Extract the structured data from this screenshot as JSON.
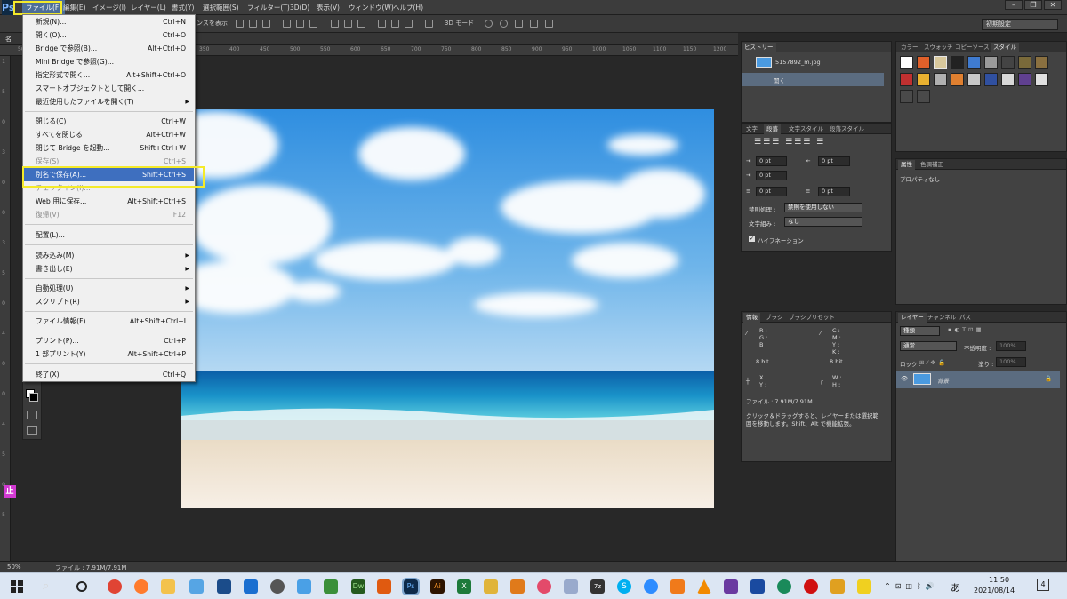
{
  "app": {
    "logo": "Ps",
    "workspace": "初期設定"
  },
  "menubar": {
    "items": [
      "ファイル(F)",
      "編集(E)",
      "イメージ(I)",
      "レイヤー(L)",
      "書式(Y)",
      "選択範囲(S)",
      "フィルター(T)",
      "3D(D)",
      "表示(V)",
      "ウィンドウ(W)",
      "ヘルプ(H)"
    ]
  },
  "options": {
    "show_transform": "ンスを表示",
    "mode_3d": "3D モード :"
  },
  "document": {
    "tab": "名",
    "zoom": "50%",
    "file_info": "ファイル : 7.91M/7.91M"
  },
  "rulers": {
    "top": [
      "50",
      "100",
      "150",
      "200",
      "250",
      "300",
      "350",
      "400",
      "450",
      "500",
      "550",
      "600",
      "650",
      "700",
      "750",
      "800",
      "850",
      "900",
      "950",
      "1000",
      "1050",
      "1100",
      "1150",
      "1200"
    ],
    "left": [
      "1",
      "5",
      "0",
      "3",
      "0",
      "0",
      "3",
      "5",
      "0",
      "4",
      "0",
      "0",
      "4",
      "5",
      "0",
      "5"
    ]
  },
  "file_menu": {
    "items": [
      {
        "label": "新規(N)...",
        "shortcut": "Ctrl+N"
      },
      {
        "label": "開く(O)...",
        "shortcut": "Ctrl+O"
      },
      {
        "label": "Bridge で参照(B)...",
        "shortcut": "Alt+Ctrl+O"
      },
      {
        "label": "Mini Bridge で参照(G)...",
        "shortcut": ""
      },
      {
        "label": "指定形式で開く...",
        "shortcut": "Alt+Shift+Ctrl+O"
      },
      {
        "label": "スマートオブジェクトとして開く...",
        "shortcut": ""
      },
      {
        "label": "最近使用したファイルを開く(T)",
        "shortcut": ""
      },
      {
        "label": "閉じる(C)",
        "shortcut": "Ctrl+W"
      },
      {
        "label": "すべてを閉じる",
        "shortcut": "Alt+Ctrl+W"
      },
      {
        "label": "閉じて Bridge を起動...",
        "shortcut": "Shift+Ctrl+W"
      },
      {
        "label": "保存(S)",
        "shortcut": "Ctrl+S"
      },
      {
        "label": "別名で保存(A)...",
        "shortcut": "Shift+Ctrl+S"
      },
      {
        "label": "チェックイン(I)...",
        "shortcut": ""
      },
      {
        "label": "Web 用に保存...",
        "shortcut": "Alt+Shift+Ctrl+S"
      },
      {
        "label": "復帰(V)",
        "shortcut": "F12"
      },
      {
        "label": "配置(L)...",
        "shortcut": ""
      },
      {
        "label": "読み込み(M)",
        "shortcut": ""
      },
      {
        "label": "書き出し(E)",
        "shortcut": ""
      },
      {
        "label": "自動処理(U)",
        "shortcut": ""
      },
      {
        "label": "スクリプト(R)",
        "shortcut": ""
      },
      {
        "label": "ファイル情報(F)...",
        "shortcut": "Alt+Shift+Ctrl+I"
      },
      {
        "label": "プリント(P)...",
        "shortcut": "Ctrl+P"
      },
      {
        "label": "1 部プリント(Y)",
        "shortcut": "Alt+Shift+Ctrl+P"
      },
      {
        "label": "終了(X)",
        "shortcut": "Ctrl+Q"
      }
    ]
  },
  "history": {
    "tab": "ヒストリー",
    "snapshot": "5157892_m.jpg",
    "state": "開く"
  },
  "swatches": {
    "tabs": [
      "カラー",
      "スウォッチ",
      "コピーソース",
      "スタイル"
    ]
  },
  "properties": {
    "tabs": [
      "属性",
      "色調補正"
    ],
    "text": "プロパティなし"
  },
  "character": {
    "tabs": [
      "文字",
      "段落",
      "文字スタイル",
      "段落スタイル"
    ],
    "values": [
      "0 pt",
      "0 pt",
      "0 pt",
      "0 pt",
      "0 pt"
    ],
    "kinsoku_label": "禁則処理 :",
    "kinsoku_value": "禁則を使用しない",
    "mojikumi_label": "文字組み :",
    "mojikumi_value": "なし",
    "hyphenation": "ハイフネーション"
  },
  "info": {
    "tabs": [
      "情報",
      "ブラシ",
      "ブラシプリセット"
    ],
    "rgb": [
      "R :",
      "G :",
      "B :"
    ],
    "cmyk": [
      "C :",
      "M :",
      "Y :",
      "K :"
    ],
    "bit1": "8 bit",
    "bit2": "8 bit",
    "xy": [
      "X :",
      "Y :"
    ],
    "wh": [
      "W :",
      "H :"
    ],
    "file": "ファイル : 7.91M/7.91M",
    "hint": "クリック＆ドラッグすると、レイヤーまたは選択範囲を移動します。Shift、Alt で機能拡張。"
  },
  "layers": {
    "tabs": [
      "レイヤー",
      "チャンネル",
      "パス"
    ],
    "filter": "種類",
    "blend": "通常",
    "opacity_label": "不透明度 :",
    "opacity": "100%",
    "lock_label": "ロック :",
    "fill_label": "塗り :",
    "fill": "100%",
    "layer_name": "背景"
  },
  "taskbar": {
    "time": "11:50",
    "date": "2021/08/14",
    "ime": "あ",
    "notif": "4"
  },
  "colors": {
    "accent": "#f4ea2a",
    "menu_select": "#3e6fbf",
    "panel": "#424242"
  }
}
